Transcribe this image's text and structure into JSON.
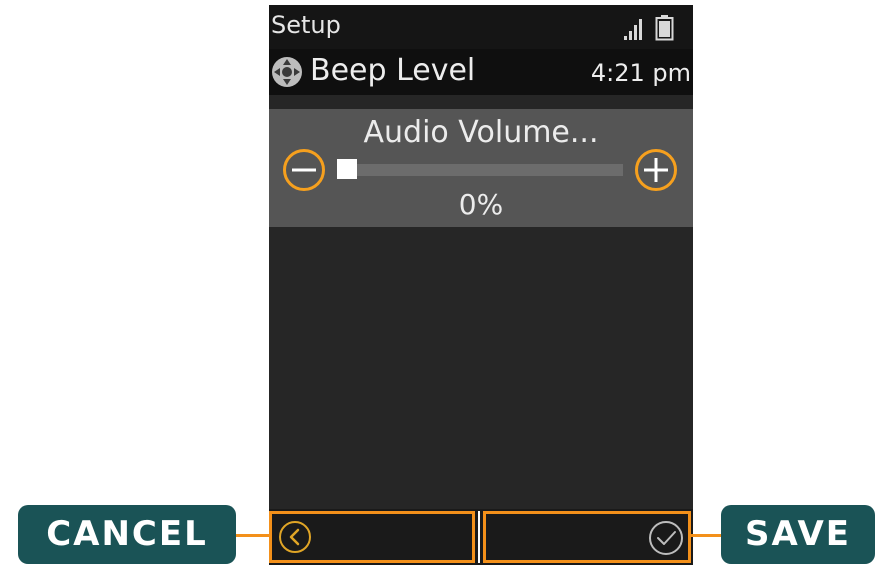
{
  "status_bar": {
    "app_label": "Setup",
    "signal_icon": "signal-bars-icon",
    "battery_icon": "battery-icon"
  },
  "header": {
    "menu_icon": "navigation-pad-icon",
    "title": "Beep Level",
    "time": "4:21 pm"
  },
  "volume": {
    "title": "Audio Volume...",
    "value_text": "0%",
    "level_percent": 0,
    "minus_icon": "minus-icon",
    "plus_icon": "plus-icon"
  },
  "softkeys": {
    "left_icon": "back-chevron-icon",
    "right_icon": "checkmark-icon"
  },
  "callouts": {
    "cancel_label": "CANCEL",
    "save_label": "SAVE"
  },
  "colors": {
    "highlight_orange": "#f3901a",
    "callout_teal": "#1a5356",
    "panel_gray": "#555555",
    "screen_background": "#262626"
  }
}
